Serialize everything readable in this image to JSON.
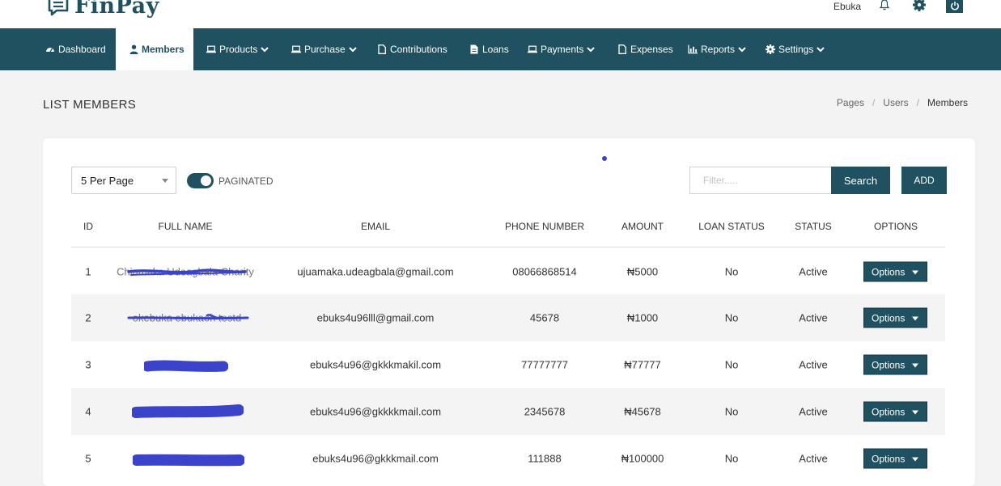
{
  "app": {
    "logo_text": "FinPay",
    "user_name": "Ebuka"
  },
  "colors": {
    "primary": "#1f5160",
    "redaction": "#3a43c9"
  },
  "nav": [
    {
      "label": "Dashboard",
      "icon": "dashboard-icon",
      "dropdown": false,
      "active": false
    },
    {
      "label": "Members",
      "icon": "user-icon",
      "dropdown": false,
      "active": true
    },
    {
      "label": "Products",
      "icon": "laptop-icon",
      "dropdown": true,
      "active": false
    },
    {
      "label": "Purchase",
      "icon": "laptop-icon",
      "dropdown": true,
      "active": false
    },
    {
      "label": "Contributions",
      "icon": "file-icon",
      "dropdown": false,
      "active": false
    },
    {
      "label": "Loans",
      "icon": "file-text-icon",
      "dropdown": false,
      "active": false
    },
    {
      "label": "Payments",
      "icon": "laptop-icon",
      "dropdown": true,
      "active": false
    },
    {
      "label": "Expenses",
      "icon": "file-icon",
      "dropdown": false,
      "active": false
    },
    {
      "label": "Reports",
      "icon": "bar-chart-icon",
      "dropdown": true,
      "active": false
    },
    {
      "label": "Settings",
      "icon": "gear-icon",
      "dropdown": true,
      "active": false
    }
  ],
  "page": {
    "title": "LIST MEMBERS",
    "breadcrumb": [
      "Pages",
      "Users",
      "Members"
    ]
  },
  "controls": {
    "per_page": "5 Per Page",
    "paginated_label": "PAGINATED",
    "paginated_on": true,
    "filter_placeholder": "Filter.....",
    "search_label": "Search",
    "add_label": "ADD"
  },
  "table": {
    "columns": [
      "ID",
      "FULL NAME",
      "EMAIL",
      "PHONE NUMBER",
      "AMOUNT",
      "LOAN STATUS",
      "STATUS",
      "OPTIONS"
    ],
    "rows": [
      {
        "id": "1",
        "full_name": "Chiamaka Udeagbala Charity",
        "email": "ujuamaka.udeagbala@gmail.com",
        "phone": "08066868514",
        "amount": "₦5000",
        "loan_status": "No",
        "status": "Active",
        "options": "Options"
      },
      {
        "id": "2",
        "full_name": "okebuka ebukaoh testd",
        "email": "ebuks4u96lll@gmail.com",
        "phone": "45678",
        "amount": "₦1000",
        "loan_status": "No",
        "status": "Active",
        "options": "Options"
      },
      {
        "id": "3",
        "full_name": "",
        "email": "ebuks4u96@gkkkmakil.com",
        "phone": "77777777",
        "amount": "₦77777",
        "loan_status": "No",
        "status": "Active",
        "options": "Options"
      },
      {
        "id": "4",
        "full_name": "",
        "email": "ebuks4u96@gkkkkmail.com",
        "phone": "2345678",
        "amount": "₦45678",
        "loan_status": "No",
        "status": "Active",
        "options": "Options"
      },
      {
        "id": "5",
        "full_name": "",
        "email": "ebuks4u96@gkkkmail.com",
        "phone": "111888",
        "amount": "₦100000",
        "loan_status": "No",
        "status": "Active",
        "options": "Options"
      }
    ]
  }
}
